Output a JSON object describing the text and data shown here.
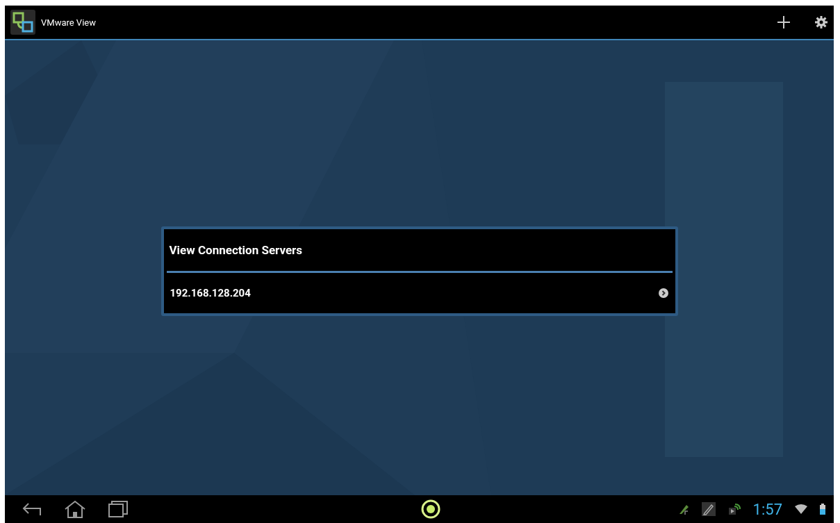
{
  "action_bar": {
    "title": "VMware View"
  },
  "dialog": {
    "title": "View Connection Servers",
    "servers": [
      {
        "address": "192.168.128.204"
      }
    ]
  },
  "status_bar": {
    "time": "1:57"
  }
}
